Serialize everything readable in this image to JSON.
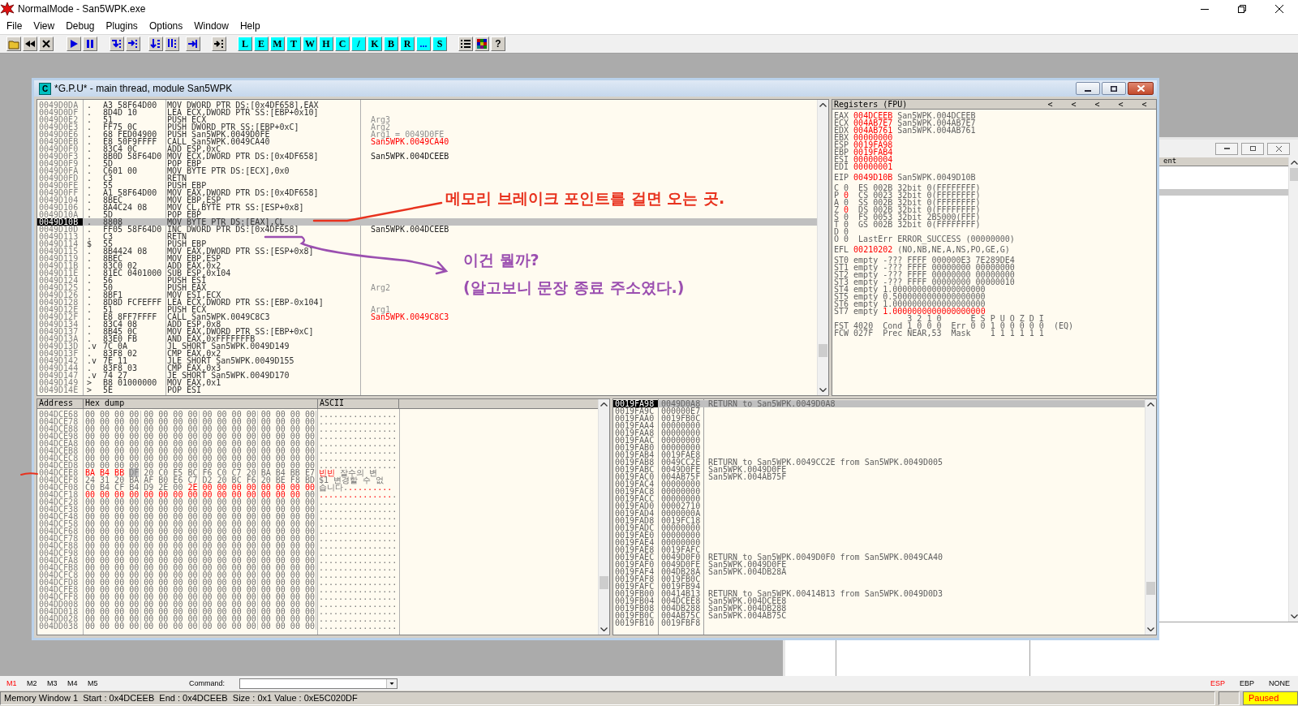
{
  "app": {
    "title": "NormalMode - San5WPK.exe"
  },
  "menu": [
    "File",
    "View",
    "Debug",
    "Plugins",
    "Options",
    "Window",
    "Help"
  ],
  "toolbar": {
    "letter_buttons": [
      "L",
      "E",
      "M",
      "T",
      "W",
      "H",
      "C",
      "/",
      "K",
      "B",
      "R",
      "...",
      "S"
    ],
    "help_button": "?"
  },
  "background_window": {
    "column_header": "ent"
  },
  "cpu_window": {
    "title": "*G.P.U* - main thread, module San5WPK",
    "icon_letter": "C"
  },
  "disassembly": {
    "rows": [
      {
        "address": "0049D0DA",
        "mark": ".",
        "hex": "A3 58F64D00",
        "command": "MOV DWORD PTR DS:[0x4DF658],EAX",
        "selected": false
      },
      {
        "address": "0049D0DF",
        "mark": ".",
        "hex": "8D4D 10",
        "command": "LEA ECX,DWORD PTR SS:[EBP+0x10]",
        "selected": false
      },
      {
        "address": "0049D0E2",
        "mark": ".",
        "hex": "51",
        "command": "PUSH ECX",
        "comment": "Arg3",
        "kind": "arg",
        "selected": false
      },
      {
        "address": "0049D0E3",
        "mark": ".",
        "hex": "FF75 0C",
        "command": "PUSH DWORD PTR SS:[EBP+0xC]",
        "comment": "Arg2",
        "kind": "arg",
        "selected": false
      },
      {
        "address": "0049D0E6",
        "mark": ".",
        "hex": "68 FED04900",
        "command": "PUSH San5WPK.0049D0FE",
        "comment": "Arg1 = 0049D0FE",
        "kind": "arg",
        "selected": false
      },
      {
        "address": "0049D0EB",
        "mark": ".",
        "hex": "E8 50F9FFFF",
        "command": "CALL San5WPK.0049CA40",
        "comment": "San5WPK.0049CA40",
        "kind": "call",
        "selected": false
      },
      {
        "address": "0049D0F0",
        "mark": ".",
        "hex": "83C4 0C",
        "command": "ADD ESP,0xC",
        "selected": false
      },
      {
        "address": "0049D0F3",
        "mark": ".",
        "hex": "8B0D 58F64D0",
        "command": "MOV ECX,DWORD PTR DS:[0x4DF658]",
        "comment": "San5WPK.004DCEEB",
        "kind": "plain",
        "selected": false
      },
      {
        "address": "0049D0F9",
        "mark": ".",
        "hex": "5D",
        "command": "POP EBP",
        "selected": false
      },
      {
        "address": "0049D0FA",
        "mark": ".",
        "hex": "C601 00",
        "command": "MOV BYTE PTR DS:[ECX],0x0",
        "selected": false
      },
      {
        "address": "0049D0FD",
        "mark": ".",
        "hex": "C3",
        "command": "RETN",
        "selected": false
      },
      {
        "address": "0049D0FE",
        "mark": ".",
        "hex": "55",
        "command": "PUSH EBP",
        "selected": false
      },
      {
        "address": "0049D0FF",
        "mark": ".",
        "hex": "A1 58F64D00",
        "command": "MOV EAX,DWORD PTR DS:[0x4DF658]",
        "selected": false
      },
      {
        "address": "0049D104",
        "mark": ".",
        "hex": "8BEC",
        "command": "MOV EBP,ESP",
        "selected": false
      },
      {
        "address": "0049D106",
        "mark": ".",
        "hex": "8A4C24 08",
        "command": "MOV CL,BYTE PTR SS:[ESP+0x8]",
        "selected": false
      },
      {
        "address": "0049D10A",
        "mark": ".",
        "hex": "5D",
        "command": "POP EBP",
        "selected": false
      },
      {
        "address": "0049D10B",
        "mark": ".",
        "hex": "8808",
        "command": "MOV BYTE PTR DS:[EAX],CL",
        "selected": true
      },
      {
        "address": "0049D10D",
        "mark": ".",
        "hex": "FF05 58F64D0",
        "command": "INC DWORD PTR DS:[0x4DF658]",
        "comment": "San5WPK.004DCEEB",
        "kind": "plain",
        "selected": false
      },
      {
        "address": "0049D113",
        "mark": ".",
        "hex": "C3",
        "command": "RETN",
        "selected": false
      },
      {
        "address": "0049D114",
        "mark": "$",
        "hex": "55",
        "command": "PUSH EBP",
        "selected": false
      },
      {
        "address": "0049D115",
        "mark": ".",
        "hex": "8B4424 08",
        "command": "MOV EAX,DWORD PTR SS:[ESP+0x8]",
        "selected": false
      },
      {
        "address": "0049D119",
        "mark": ".",
        "hex": "8BEC",
        "command": "MOV EBP,ESP",
        "selected": false
      },
      {
        "address": "0049D11B",
        "mark": ".",
        "hex": "83C0 02",
        "command": "ADD EAX,0x2",
        "selected": false
      },
      {
        "address": "0049D11E",
        "mark": ".",
        "hex": "81EC 0401000",
        "command": "SUB ESP,0x104",
        "selected": false
      },
      {
        "address": "0049D124",
        "mark": ".",
        "hex": "56",
        "command": "PUSH ESI",
        "selected": false
      },
      {
        "address": "0049D125",
        "mark": ".",
        "hex": "50",
        "command": "PUSH EAX",
        "comment": "Arg2",
        "kind": "arg",
        "selected": false
      },
      {
        "address": "0049D126",
        "mark": ".",
        "hex": "8BF1",
        "command": "MOV ESI,ECX",
        "selected": false
      },
      {
        "address": "0049D128",
        "mark": ".",
        "hex": "8D8D FCFEFFF",
        "command": "LEA ECX,DWORD PTR SS:[EBP-0x104]",
        "selected": false
      },
      {
        "address": "0049D12E",
        "mark": ".",
        "hex": "51",
        "command": "PUSH ECX",
        "comment": "Arg1",
        "kind": "arg",
        "selected": false
      },
      {
        "address": "0049D12F",
        "mark": ".",
        "hex": "E8 8FF7FFFF",
        "command": "CALL San5WPK.0049C8C3",
        "comment": "San5WPK.0049C8C3",
        "kind": "call",
        "selected": false
      },
      {
        "address": "0049D134",
        "mark": ".",
        "hex": "83C4 08",
        "command": "ADD ESP,0x8",
        "selected": false
      },
      {
        "address": "0049D137",
        "mark": ".",
        "hex": "8B45 0C",
        "command": "MOV EAX,DWORD PTR SS:[EBP+0xC]",
        "selected": false
      },
      {
        "address": "0049D13A",
        "mark": ".",
        "hex": "83E0 FB",
        "command": "AND EAX,0xFFFFFFFB",
        "selected": false
      },
      {
        "address": "0049D13D",
        "mark": ".v",
        "hex": "7C 0A",
        "command": "JL SHORT San5WPK.0049D149",
        "selected": false
      },
      {
        "address": "0049D13F",
        "mark": ".",
        "hex": "83F8 02",
        "command": "CMP EAX,0x2",
        "selected": false
      },
      {
        "address": "0049D142",
        "mark": ".v",
        "hex": "7E 11",
        "command": "JLE SHORT San5WPK.0049D155",
        "selected": false
      },
      {
        "address": "0049D144",
        "mark": ".",
        "hex": "83F8 03",
        "command": "CMP EAX,0x3",
        "selected": false
      },
      {
        "address": "0049D147",
        "mark": ".v",
        "hex": "74 27",
        "command": "JE SHORT San5WPK.0049D170",
        "selected": false
      },
      {
        "address": "0049D149",
        "mark": ">",
        "hex": "B8 01000000",
        "command": "MOV EAX,0x1",
        "selected": false
      },
      {
        "address": "0049D14E",
        "mark": ">",
        "hex": "5E",
        "command": "POP ESI",
        "selected": false
      }
    ]
  },
  "registers": {
    "title": "Registers (FPU)",
    "arrows": [
      "<",
      "<",
      "<",
      "<",
      "<"
    ],
    "groups": [
      [
        {
          "parts": [
            {
              "text": "EAX ",
              "changed": false
            },
            {
              "text": "004DCEEB",
              "changed": true
            },
            {
              "text": " San5WPK.004DCEEB",
              "changed": false
            }
          ]
        },
        {
          "parts": [
            {
              "text": "ECX ",
              "changed": false
            },
            {
              "text": "004AB7E7",
              "changed": true
            },
            {
              "text": " San5WPK.004AB7E7",
              "changed": false
            }
          ]
        },
        {
          "parts": [
            {
              "text": "EDX ",
              "changed": false
            },
            {
              "text": "004AB761",
              "changed": true
            },
            {
              "text": " San5WPK.004AB761",
              "changed": false
            }
          ]
        },
        {
          "parts": [
            {
              "text": "EBX ",
              "changed": false
            },
            {
              "text": "00000000",
              "changed": true
            }
          ]
        },
        {
          "parts": [
            {
              "text": "ESP ",
              "changed": false
            },
            {
              "text": "0019FA98",
              "changed": true
            }
          ]
        },
        {
          "parts": [
            {
              "text": "EBP ",
              "changed": false
            },
            {
              "text": "0019FAB4",
              "changed": true
            }
          ]
        },
        {
          "parts": [
            {
              "text": "ESI ",
              "changed": false
            },
            {
              "text": "00000004",
              "changed": true
            }
          ]
        },
        {
          "parts": [
            {
              "text": "EDI ",
              "changed": false
            },
            {
              "text": "00000001",
              "changed": true
            }
          ]
        }
      ],
      [
        {
          "parts": [
            {
              "text": "EIP ",
              "changed": false
            },
            {
              "text": "0049D10B",
              "changed": true
            },
            {
              "text": " San5WPK.0049D10B",
              "changed": false
            }
          ]
        }
      ],
      [
        {
          "parts": [
            {
              "text": "C 0  ES 002B 32bit 0(FFFFFFFF)",
              "changed": false
            }
          ]
        },
        {
          "parts": [
            {
              "text": "P ",
              "changed": false
            },
            {
              "text": "0",
              "changed": true
            },
            {
              "text": "  CS 0023 32bit 0(FFFFFFFF)",
              "changed": false
            }
          ]
        },
        {
          "parts": [
            {
              "text": "A 0  SS 002B 32bit 0(FFFFFFFF)",
              "changed": false
            }
          ]
        },
        {
          "parts": [
            {
              "text": "Z ",
              "changed": false
            },
            {
              "text": "0",
              "changed": true
            },
            {
              "text": "  DS 002B 32bit 0(FFFFFFFF)",
              "changed": false
            }
          ]
        },
        {
          "parts": [
            {
              "text": "S 0  FS 0053 32bit 2B5000(FFF)",
              "changed": false
            }
          ]
        },
        {
          "parts": [
            {
              "text": "T 0  GS 002B 32bit 0(FFFFFFFF)",
              "changed": false
            }
          ]
        },
        {
          "parts": [
            {
              "text": "D 0",
              "changed": false
            }
          ]
        },
        {
          "parts": [
            {
              "text": "O 0  LastErr ERROR_SUCCESS (00000000)",
              "changed": false
            }
          ]
        }
      ],
      [
        {
          "parts": [
            {
              "text": "EFL ",
              "changed": false
            },
            {
              "text": "00210202",
              "changed": true
            },
            {
              "text": " (NO,NB,NE,A,NS,PO,GE,G)",
              "changed": false
            }
          ]
        }
      ],
      [
        {
          "parts": [
            {
              "text": "ST0 empty -??? FFFF 000000E3 7E289DE4",
              "changed": false
            }
          ]
        },
        {
          "parts": [
            {
              "text": "ST1 empty -??? FFFF 00000000 00000000",
              "changed": false
            }
          ]
        },
        {
          "parts": [
            {
              "text": "ST2 empty -??? FFFF 00000000 00000000",
              "changed": false
            }
          ]
        },
        {
          "parts": [
            {
              "text": "ST3 empty -??? FFFF 00000000 00000010",
              "changed": false
            }
          ]
        },
        {
          "parts": [
            {
              "text": "ST4 empty 1.0000000000000000000",
              "changed": false
            }
          ]
        },
        {
          "parts": [
            {
              "text": "ST5 empty 0.5000000000000000000",
              "changed": false
            }
          ]
        },
        {
          "parts": [
            {
              "text": "ST6 empty 1.0000000000000000000",
              "changed": false
            }
          ]
        },
        {
          "parts": [
            {
              "text": "ST7 empty ",
              "changed": false
            },
            {
              "text": "1.0000000000000000000",
              "changed": true
            }
          ]
        },
        {
          "parts": [
            {
              "text": "               3 2 1 0      E S P U O Z D I",
              "changed": false
            }
          ]
        },
        {
          "parts": [
            {
              "text": "FST 4020  Cond 1 0 0 0  Err 0 0 1 0 0 0 0 0  (EQ)",
              "changed": false
            }
          ]
        },
        {
          "parts": [
            {
              "text": "FCW 027F  Prec NEAR,53  Mask    1 1 1 1 1 1",
              "changed": false
            }
          ]
        }
      ]
    ]
  },
  "dump": {
    "columns": [
      "Address",
      "Hex dump",
      "ASCII"
    ],
    "rows": [
      {
        "address": "004DCE68",
        "hex": [
          {
            "text": "00 00 00 00 00 00 00 00 00 00 00 00 00 00 00 00",
            "kind": "normal"
          }
        ],
        "ascii": [
          {
            "text": "................",
            "kind": "normal"
          }
        ]
      },
      {
        "address": "004DCE78",
        "hex": [
          {
            "text": "00 00 00 00 00 00 00 00 00 00 00 00 00 00 00 00",
            "kind": "normal"
          }
        ],
        "ascii": [
          {
            "text": "................",
            "kind": "normal"
          }
        ]
      },
      {
        "address": "004DCE88",
        "hex": [
          {
            "text": "00 00 00 00 00 00 00 00 00 00 00 00 00 00 00 00",
            "kind": "normal"
          }
        ],
        "ascii": [
          {
            "text": "................",
            "kind": "normal"
          }
        ]
      },
      {
        "address": "004DCE98",
        "hex": [
          {
            "text": "00 00 00 00 00 00 00 00 00 00 00 00 00 00 00 00",
            "kind": "normal"
          }
        ],
        "ascii": [
          {
            "text": "................",
            "kind": "normal"
          }
        ]
      },
      {
        "address": "004DCEA8",
        "hex": [
          {
            "text": "00 00 00 00 00 00 00 00 00 00 00 00 00 00 00 00",
            "kind": "normal"
          }
        ],
        "ascii": [
          {
            "text": "................",
            "kind": "normal"
          }
        ]
      },
      {
        "address": "004DCEB8",
        "hex": [
          {
            "text": "00 00 00 00 00 00 00 00 00 00 00 00 00 00 00 00",
            "kind": "normal"
          }
        ],
        "ascii": [
          {
            "text": "................",
            "kind": "normal"
          }
        ]
      },
      {
        "address": "004DCEC8",
        "hex": [
          {
            "text": "00 00 00 00 00 00 00 00 00 00 00 00 00 00 00 00",
            "kind": "normal"
          }
        ],
        "ascii": [
          {
            "text": "................",
            "kind": "normal"
          }
        ]
      },
      {
        "address": "004DCED8",
        "hex": [
          {
            "text": "00 00 00 00 00 00 00 00 00 00 00 00 00 00 00 00",
            "kind": "normal"
          }
        ],
        "ascii": [
          {
            "text": "................",
            "kind": "normal"
          }
        ]
      },
      {
        "address": "004DCEE8",
        "hex": [
          {
            "text": "BA B4 BB",
            "kind": "changed"
          },
          {
            "text": "DF",
            "kind": "selected"
          },
          {
            "text": "20 C0 E5 BC F6 C0 C7 20 BA B4 BB E7",
            "kind": "normal"
          }
        ],
        "ascii": [
          {
            "text": "빈빈",
            "kind": "changed"
          },
          {
            "text": " 잘수의 변",
            "kind": "normal"
          }
        ]
      },
      {
        "address": "004DCEF8",
        "hex": [
          {
            "text": "24 31 20 BA AF B0 E6 C7 D2 20 BC F6 20 BE F8 BD",
            "kind": "normal"
          }
        ],
        "ascii": [
          {
            "text": "$1 변경할 수 없",
            "kind": "normal"
          }
        ]
      },
      {
        "address": "004DCF08",
        "hex": [
          {
            "text": "C0 B4 CF B4 D9 2E 00",
            "kind": "normal"
          },
          {
            "text": "2E 00 00 00 00 00 00 00 00",
            "kind": "changed"
          }
        ],
        "ascii": [
          {
            "text": "습니다.",
            "kind": "normal"
          },
          {
            "text": ".........",
            "kind": "changed"
          }
        ]
      },
      {
        "address": "004DCF18",
        "hex": [
          {
            "text": "00 00 00 00 00 00 00 00 00 00 00 00 00 00 00",
            "kind": "changed"
          },
          {
            "text": "00",
            "kind": "normal"
          }
        ],
        "ascii": [
          {
            "text": "...............",
            "kind": "changed"
          },
          {
            "text": ".",
            "kind": "normal"
          }
        ]
      },
      {
        "address": "004DCF28",
        "hex": [
          {
            "text": "00 00 00 00 00 00 00 00 00 00 00 00 00 00 00 00",
            "kind": "normal"
          }
        ],
        "ascii": [
          {
            "text": "................",
            "kind": "normal"
          }
        ]
      },
      {
        "address": "004DCF38",
        "hex": [
          {
            "text": "00 00 00 00 00 00 00 00 00 00 00 00 00 00 00 00",
            "kind": "normal"
          }
        ],
        "ascii": [
          {
            "text": "................",
            "kind": "normal"
          }
        ]
      },
      {
        "address": "004DCF48",
        "hex": [
          {
            "text": "00 00 00 00 00 00 00 00 00 00 00 00 00 00 00 00",
            "kind": "normal"
          }
        ],
        "ascii": [
          {
            "text": "................",
            "kind": "normal"
          }
        ]
      },
      {
        "address": "004DCF58",
        "hex": [
          {
            "text": "00 00 00 00 00 00 00 00 00 00 00 00 00 00 00 00",
            "kind": "normal"
          }
        ],
        "ascii": [
          {
            "text": "................",
            "kind": "normal"
          }
        ]
      },
      {
        "address": "004DCF68",
        "hex": [
          {
            "text": "00 00 00 00 00 00 00 00 00 00 00 00 00 00 00 00",
            "kind": "normal"
          }
        ],
        "ascii": [
          {
            "text": "................",
            "kind": "normal"
          }
        ]
      },
      {
        "address": "004DCF78",
        "hex": [
          {
            "text": "00 00 00 00 00 00 00 00 00 00 00 00 00 00 00 00",
            "kind": "normal"
          }
        ],
        "ascii": [
          {
            "text": "................",
            "kind": "normal"
          }
        ]
      },
      {
        "address": "004DCF88",
        "hex": [
          {
            "text": "00 00 00 00 00 00 00 00 00 00 00 00 00 00 00 00",
            "kind": "normal"
          }
        ],
        "ascii": [
          {
            "text": "................",
            "kind": "normal"
          }
        ]
      },
      {
        "address": "004DCF98",
        "hex": [
          {
            "text": "00 00 00 00 00 00 00 00 00 00 00 00 00 00 00 00",
            "kind": "normal"
          }
        ],
        "ascii": [
          {
            "text": "................",
            "kind": "normal"
          }
        ]
      },
      {
        "address": "004DCFA8",
        "hex": [
          {
            "text": "00 00 00 00 00 00 00 00 00 00 00 00 00 00 00 00",
            "kind": "normal"
          }
        ],
        "ascii": [
          {
            "text": "................",
            "kind": "normal"
          }
        ]
      },
      {
        "address": "004DCFB8",
        "hex": [
          {
            "text": "00 00 00 00 00 00 00 00 00 00 00 00 00 00 00 00",
            "kind": "normal"
          }
        ],
        "ascii": [
          {
            "text": "................",
            "kind": "normal"
          }
        ]
      },
      {
        "address": "004DCFC8",
        "hex": [
          {
            "text": "00 00 00 00 00 00 00 00 00 00 00 00 00 00 00 00",
            "kind": "normal"
          }
        ],
        "ascii": [
          {
            "text": "................",
            "kind": "normal"
          }
        ]
      },
      {
        "address": "004DCFD8",
        "hex": [
          {
            "text": "00 00 00 00 00 00 00 00 00 00 00 00 00 00 00 00",
            "kind": "normal"
          }
        ],
        "ascii": [
          {
            "text": "................",
            "kind": "normal"
          }
        ]
      },
      {
        "address": "004DCFE8",
        "hex": [
          {
            "text": "00 00 00 00 00 00 00 00 00 00 00 00 00 00 00 00",
            "kind": "normal"
          }
        ],
        "ascii": [
          {
            "text": "................",
            "kind": "normal"
          }
        ]
      },
      {
        "address": "004DCFF8",
        "hex": [
          {
            "text": "00 00 00 00 00 00 00 00 00 00 00 00 00 00 00 00",
            "kind": "normal"
          }
        ],
        "ascii": [
          {
            "text": "................",
            "kind": "normal"
          }
        ]
      },
      {
        "address": "004DD008",
        "hex": [
          {
            "text": "00 00 00 00 00 00 00 00 00 00 00 00 00 00 00 00",
            "kind": "normal"
          }
        ],
        "ascii": [
          {
            "text": "................",
            "kind": "normal"
          }
        ]
      },
      {
        "address": "004DD018",
        "hex": [
          {
            "text": "00 00 00 00 00 00 00 00 00 00 00 00 00 00 00 00",
            "kind": "normal"
          }
        ],
        "ascii": [
          {
            "text": "................",
            "kind": "normal"
          }
        ]
      },
      {
        "address": "004DD028",
        "hex": [
          {
            "text": "00 00 00 00 00 00 00 00 00 00 00 00 00 00 00 00",
            "kind": "normal"
          }
        ],
        "ascii": [
          {
            "text": "................",
            "kind": "normal"
          }
        ]
      },
      {
        "address": "004DD038",
        "hex": [
          {
            "text": "00 00 00 00 00 00 00 00 00 00 00 00 00 00 00 00",
            "kind": "normal"
          }
        ],
        "ascii": [
          {
            "text": "................",
            "kind": "normal"
          }
        ]
      }
    ]
  },
  "stack": {
    "rows": [
      {
        "address": "0019FA98",
        "value": "0049D0A8",
        "comment": "RETURN to San5WPK.0049D0A8",
        "selected": true
      },
      {
        "address": "0019FA9C",
        "value": "000000E7",
        "selected": false
      },
      {
        "address": "0019FAA0",
        "value": "0019FB0C",
        "selected": false
      },
      {
        "address": "0019FAA4",
        "value": "00000000",
        "selected": false
      },
      {
        "address": "0019FAA8",
        "value": "00000000",
        "selected": false
      },
      {
        "address": "0019FAAC",
        "value": "00000000",
        "selected": false
      },
      {
        "address": "0019FAB0",
        "value": "00000000",
        "selected": false
      },
      {
        "address": "0019FAB4",
        "value": "0019FAE8",
        "selected": false
      },
      {
        "address": "0019FAB8",
        "value": "0049CC2E",
        "comment": "RETURN to San5WPK.0049CC2E from San5WPK.0049D005",
        "selected": false
      },
      {
        "address": "0019FABC",
        "value": "0049D0FE",
        "comment": "San5WPK.0049D0FE",
        "selected": false
      },
      {
        "address": "0019FAC0",
        "value": "004AB75F",
        "comment": "San5WPK.004AB75F",
        "selected": false
      },
      {
        "address": "0019FAC4",
        "value": "00000000",
        "selected": false
      },
      {
        "address": "0019FAC8",
        "value": "00000000",
        "selected": false
      },
      {
        "address": "0019FACC",
        "value": "00000000",
        "selected": false
      },
      {
        "address": "0019FAD0",
        "value": "00002710",
        "selected": false
      },
      {
        "address": "0019FAD4",
        "value": "0000000A",
        "selected": false
      },
      {
        "address": "0019FAD8",
        "value": "0019FC18",
        "selected": false
      },
      {
        "address": "0019FADC",
        "value": "00000000",
        "selected": false
      },
      {
        "address": "0019FAE0",
        "value": "00000000",
        "selected": false
      },
      {
        "address": "0019FAE4",
        "value": "00000000",
        "selected": false
      },
      {
        "address": "0019FAE8",
        "value": "0019FAFC",
        "selected": false
      },
      {
        "address": "0019FAEC",
        "value": "0049D0F0",
        "comment": "RETURN to San5WPK.0049D0F0 from San5WPK.0049CA40",
        "selected": false
      },
      {
        "address": "0019FAF0",
        "value": "0049D0FE",
        "comment": "San5WPK.0049D0FE",
        "selected": false
      },
      {
        "address": "0019FAF4",
        "value": "004DB28A",
        "comment": "San5WPK.004DB28A",
        "selected": false
      },
      {
        "address": "0019FAF8",
        "value": "0019FB0C",
        "selected": false
      },
      {
        "address": "0019FAFC",
        "value": "0019FB94",
        "selected": false
      },
      {
        "address": "0019FB00",
        "value": "00414B13",
        "comment": "RETURN to San5WPK.00414B13 from San5WPK.0049D0D3",
        "selected": false
      },
      {
        "address": "0019FB04",
        "value": "004DCEE8",
        "comment": "San5WPK.004DCEE8",
        "selected": false
      },
      {
        "address": "0019FB08",
        "value": "004DB288",
        "comment": "San5WPK.004DB288",
        "selected": false
      },
      {
        "address": "0019FB0C",
        "value": "004AB75C",
        "comment": "San5WPK.004AB75C",
        "selected": false
      },
      {
        "address": "0019FB10",
        "value": "0019FBF8",
        "selected": false
      }
    ]
  },
  "annotations": [
    {
      "kind": "pointer-line",
      "text": "메모리 브레이크 포인트를 걸면 오는 곳.",
      "color": "#e8321e"
    },
    {
      "kind": "arrow",
      "text": "이건 뭘까?",
      "color": "#9b4fb0"
    },
    {
      "kind": "note",
      "text": "(알고보니 문장 종료 주소였다.)",
      "color": "#9b4fb0"
    }
  ],
  "command_bar": {
    "memory_buttons": [
      {
        "label": "M1",
        "selected": true
      },
      {
        "label": "M2",
        "selected": false
      },
      {
        "label": "M3",
        "selected": false
      },
      {
        "label": "M4",
        "selected": false
      },
      {
        "label": "M5",
        "selected": false
      }
    ],
    "command_label": "Command:",
    "register_buttons": [
      {
        "label": "ESP",
        "selected": true
      },
      {
        "label": "EBP",
        "selected": false
      },
      {
        "label": "NONE",
        "selected": false
      }
    ]
  },
  "status_bar": {
    "text": "Memory Window 1  Start : 0x4DCEEB  End : 0x4DCEEB  Size : 0x1 Value : 0xE5C020DF",
    "state": "Paused"
  }
}
